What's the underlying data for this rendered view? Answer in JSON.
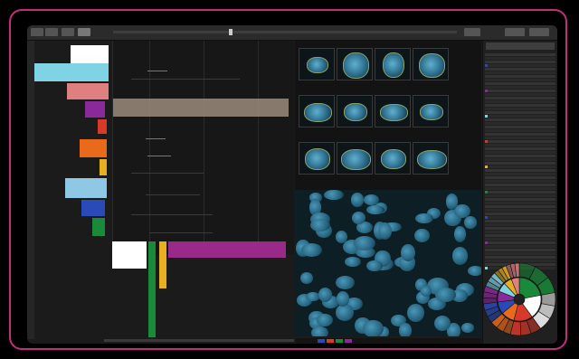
{
  "toolbar": {
    "left_buttons": [
      "tb-a",
      "tb-b",
      "tb-c",
      "tb-d"
    ],
    "right_buttons": [
      "tb-e",
      "tb-f",
      "tb-g"
    ],
    "timeline_position": 0.34
  },
  "hierarchy_colors": {
    "white": "#ffffff",
    "cyan": "#7fd3e4",
    "salmon": "#e07f7f",
    "purple": "#8a2a9a",
    "red": "#d83a2a",
    "orange": "#e86a1a",
    "yellow": "#e8b020",
    "lightblue": "#8fc8e4",
    "blue": "#2a4ab8",
    "green": "#1a8a3a",
    "magenta": "#9a2a8a"
  },
  "gallery": {
    "rows": 3,
    "cols": 4,
    "stain_colors": [
      "#5fb0d0",
      "#2d6f8c",
      "#8aa36a"
    ]
  },
  "microscopy": {
    "channel": "nucleus",
    "color": "#4a97b8"
  },
  "sunburst": {
    "segments": [
      {
        "color": "#1a8a3a",
        "value": 22
      },
      {
        "color": "#ffffff",
        "value": 18
      },
      {
        "color": "#d83a2a",
        "value": 14
      },
      {
        "color": "#e86a1a",
        "value": 10
      },
      {
        "color": "#2a4ab8",
        "value": 9
      },
      {
        "color": "#8a2a9a",
        "value": 8
      },
      {
        "color": "#7fd3e4",
        "value": 7
      },
      {
        "color": "#e8b020",
        "value": 6
      },
      {
        "color": "#e07f7f",
        "value": 6
      }
    ]
  },
  "status_bar_colors": [
    "#2a4ab8",
    "#d83a2a",
    "#1a8a3a",
    "#8a2a9a"
  ]
}
